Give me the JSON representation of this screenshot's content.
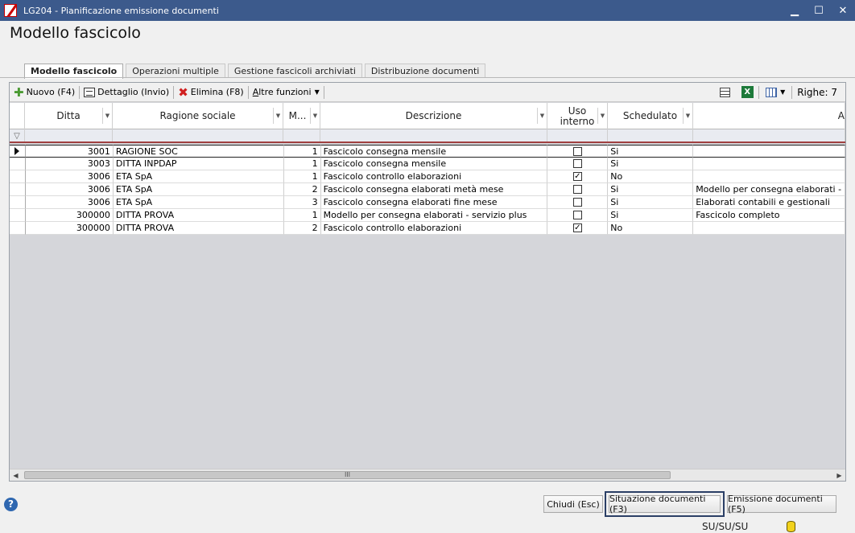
{
  "window": {
    "title": "LG204 - Pianificazione emissione documenti",
    "minimize": "▁",
    "maximize": "☐",
    "close": "✕"
  },
  "page_title": "Modello fascicolo",
  "tabs": [
    {
      "label": "Modello fascicolo",
      "active": true
    },
    {
      "label": "Operazioni multiple"
    },
    {
      "label": "Gestione fascicoli archiviati"
    },
    {
      "label": "Distribuzione documenti"
    }
  ],
  "toolbar": {
    "nuovo": "Nuovo (F4)",
    "dettaglio": "Dettaglio (Invio)",
    "elimina": "Elimina (F8)",
    "altre_prefix": "A",
    "altre_rest": "ltre funzioni",
    "righe": "Righe: 7"
  },
  "columns": {
    "ditta": "Ditta",
    "ragione": "Ragione sociale",
    "m": "M...",
    "descrizione": "Descrizione",
    "uso1": "Uso",
    "uso2": "interno",
    "schedulato": "Schedulato",
    "last": "A"
  },
  "rows": [
    {
      "ditta": "3001",
      "ragione": "RAGIONE SOC",
      "m": "1",
      "descrizione": "Fascicolo consegna mensile",
      "uso": "",
      "sched": "Si",
      "note": ""
    },
    {
      "ditta": "3003",
      "ragione": "DITTA INPDAP",
      "m": "1",
      "descrizione": "Fascicolo consegna mensile",
      "uso": "",
      "sched": "Si",
      "note": ""
    },
    {
      "ditta": "3006",
      "ragione": "ETA SpA",
      "m": "1",
      "descrizione": "Fascicolo controllo elaborazioni",
      "uso": "✓",
      "sched": "No",
      "note": ""
    },
    {
      "ditta": "3006",
      "ragione": "ETA SpA",
      "m": "2",
      "descrizione": "Fascicolo consegna elaborati metà mese",
      "uso": "",
      "sched": "Si",
      "note": "Modello per consegna elaborati -"
    },
    {
      "ditta": "3006",
      "ragione": "ETA SpA",
      "m": "3",
      "descrizione": "Fascicolo consegna elaborati fine mese",
      "uso": "",
      "sched": "Si",
      "note": "Elaborati contabili e gestionali"
    },
    {
      "ditta": "300000",
      "ragione": "DITTA PROVA",
      "m": "1",
      "descrizione": "Modello per consegna elaborati - servizio plus",
      "uso": "",
      "sched": "Si",
      "note": "Fascicolo completo"
    },
    {
      "ditta": "300000",
      "ragione": "DITTA PROVA",
      "m": "2",
      "descrizione": "Fascicolo controllo elaborazioni",
      "uso": "✓",
      "sched": "No",
      "note": ""
    }
  ],
  "buttons": {
    "chiudi": "Chiudi (Esc)",
    "situazione": "Situazione documenti (F3)",
    "emissione": "Emissione documenti (F5)"
  },
  "status": {
    "user": "SU/SU/SU"
  },
  "scroll_glyph": "III",
  "colors": {
    "titlebar": "#3c5a8c",
    "accent_focus": "#2b3f66"
  }
}
